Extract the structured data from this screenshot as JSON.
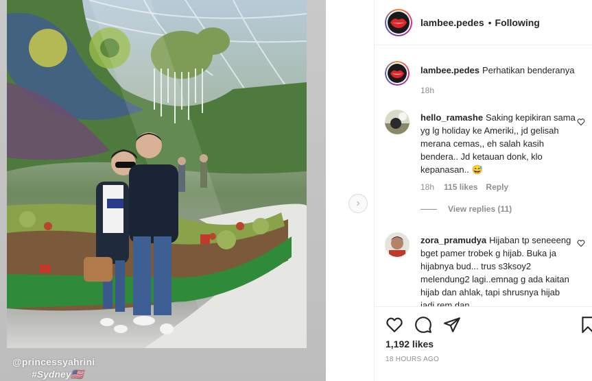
{
  "post": {
    "image_overlay": {
      "mention": "@princessyahrini",
      "hashtag": "#Sydney🇺🇸"
    }
  },
  "header": {
    "username": "lambee.pedes",
    "separator": "•",
    "follow_status": "Following"
  },
  "comments": [
    {
      "username": "lambee.pedes",
      "text": "Perhatikan benderanya",
      "time": "18h"
    },
    {
      "username": "hello_ramashe",
      "text": "Saking kepikiran sama yg lg holiday ke Ameriki,, jd gelisah merana cemas,, eh salah kasih bendera.. Jd ketauan donk, klo kepanasan.. 😅",
      "time": "18h",
      "likes": "115 likes",
      "reply_label": "Reply",
      "view_replies": "View replies (11)"
    },
    {
      "username": "zora_pramudya",
      "text": "Hijaban tp seneeeng bget pamer trobek g hijab. Buka ja hijabnya bud... trus s3ksoy2 melendung2 lagi..emnag g ada kaitan hijab dan ahlak, tapi shrusnya hijab jadi rem dan"
    }
  ],
  "footer": {
    "likes": "1,192 likes",
    "timestamp": "18 HOURS AGO"
  },
  "colors": {
    "text": "#262626",
    "muted": "#8e8e8e",
    "border": "#efefef"
  }
}
